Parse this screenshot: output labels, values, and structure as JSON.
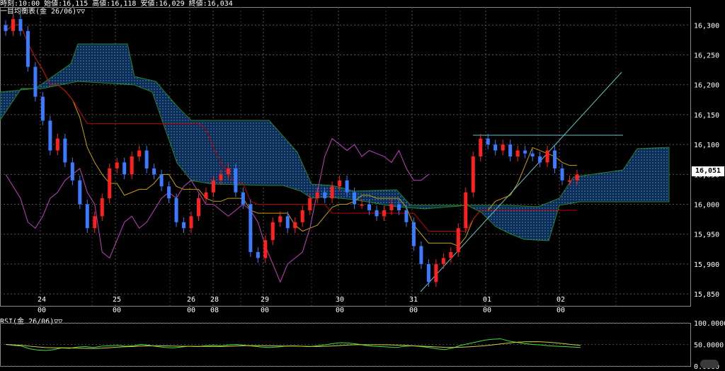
{
  "header": {
    "ohlc_line": "時刻:10:00 始値:16,115 高値:16,118 安値:16,029 終値:16,034",
    "main_title": "一目均衡表(金 26/06)▽▽",
    "rsi_title": "RSI(金 26/06)▽▽"
  },
  "price_axis": {
    "ticks": [
      "16,300",
      "16,250",
      "16,200",
      "16,150",
      "16,100",
      "16,050",
      "16,000",
      "15,950",
      "15,900",
      "15,850"
    ],
    "last_price": "16,051"
  },
  "time_axis": {
    "labels": [
      {
        "day": "24",
        "time": "00"
      },
      {
        "day": "25",
        "time": "00"
      },
      {
        "day": "26",
        "time": "00"
      },
      {
        "day": "28",
        "time": "08"
      },
      {
        "day": "29",
        "time": "00"
      },
      {
        "day": "30",
        "time": "00"
      },
      {
        "day": "31",
        "time": "00"
      },
      {
        "day": "01",
        "time": "00"
      },
      {
        "day": "02",
        "time": "00"
      }
    ]
  },
  "rsi_axis": {
    "ticks": [
      "100.0000",
      "50.0000",
      "0.0000"
    ]
  },
  "colors": {
    "up": "#ff2020",
    "down": "#3a7bff",
    "cloud": "#1f5fb0",
    "tenkan": "#c8a000",
    "kijun": "#c00000",
    "chikou": "#c040c0",
    "trend": "#6cc0c0",
    "rsi": "#40e040",
    "rsi_sig": "#d0d040"
  },
  "chart_data": {
    "type": "line",
    "title": "一目均衡表(金 26/06)",
    "ylim": [
      15830,
      16330
    ],
    "x_categories": [
      "24",
      "25",
      "26",
      "28",
      "29",
      "30",
      "31",
      "01",
      "02"
    ],
    "price_series": [
      {
        "name": "close",
        "values": [
          16290,
          16310,
          16290,
          16230,
          16180,
          16140,
          16090,
          16110,
          16070,
          16040,
          16000,
          15960,
          15980,
          16010,
          16060,
          16070,
          16050,
          16080,
          16090,
          16060,
          16050,
          16030,
          16010,
          15970,
          15960,
          15980,
          16010,
          16020,
          16040,
          16050,
          16060,
          16020,
          16000,
          15920,
          15910,
          15940,
          15970,
          15980,
          15960,
          15970,
          15990,
          16010,
          16020,
          16010,
          16030,
          16040,
          16020,
          16000,
          16000,
          15990,
          15980,
          15990,
          16000,
          15990,
          15970,
          15930,
          15900,
          15870,
          15900,
          15910,
          15920,
          15960,
          16020,
          16080,
          16110,
          16100,
          16090,
          16100,
          16080,
          16090,
          16085,
          16080,
          16070,
          16090,
          16060,
          16040,
          16040,
          16050
        ]
      }
    ],
    "rsi_ylim": [
      0,
      100
    ],
    "rsi_series": [
      {
        "name": "RSI",
        "values": [
          50,
          48,
          46,
          40,
          37,
          36,
          38,
          42,
          41,
          44,
          45,
          43,
          46,
          47,
          48,
          46,
          47,
          50,
          48,
          45,
          43,
          42,
          44,
          46,
          45,
          47,
          48,
          47,
          49,
          50,
          48,
          46,
          44,
          43,
          44,
          46,
          47,
          46,
          45,
          47,
          49,
          52,
          54,
          53,
          51,
          48,
          46,
          45,
          44,
          43,
          46,
          47,
          45,
          43,
          40,
          38,
          42,
          48,
          52,
          56,
          60,
          62,
          63,
          58,
          55,
          52,
          50,
          49,
          47,
          46,
          45,
          44,
          43
        ]
      }
    ]
  }
}
